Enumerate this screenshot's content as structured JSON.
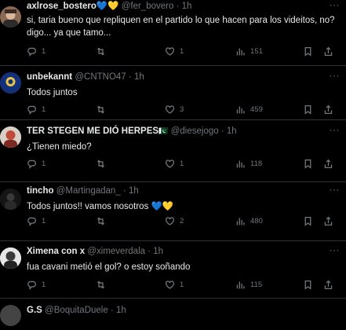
{
  "tweets": [
    {
      "name": "axlrose_bostero",
      "handle": "@fer_bovero",
      "dot": "·",
      "time": "1h",
      "emoji": "💙💛",
      "text": "si, taria bueno que repliquen en el partido lo que hacen para los videitos, no? digo... ya que tamo...",
      "replies": "1",
      "retweets": "",
      "likes": "1",
      "views": "151"
    },
    {
      "name": "unbekannt",
      "handle": "@CNTNO47",
      "dot": "·",
      "time": "1h",
      "emoji": "",
      "text": "Todos juntos",
      "replies": "1",
      "retweets": "",
      "likes": "3",
      "views": "459"
    },
    {
      "name": "TER STEGEN ME DIÓ HERPES",
      "handle": "@diesejogo",
      "dot": "·",
      "time": "1h",
      "emoji": "🇵🇰",
      "text": "¿Tienen miedo?",
      "replies": "1",
      "retweets": "",
      "likes": "1",
      "views": "118"
    },
    {
      "name": "tincho",
      "handle": "@Martingadan_",
      "dot": "·",
      "time": "1h",
      "emoji": "",
      "text": "Todos juntos!! vamos nosotros 💙💛",
      "replies": "1",
      "retweets": "",
      "likes": "2",
      "views": "480"
    },
    {
      "name": "Ximena con x",
      "handle": "@ximeverdala",
      "dot": "·",
      "time": "1h",
      "emoji": "",
      "text": "fua cavani metió el gol? o estoy soñando",
      "replies": "1",
      "retweets": "",
      "likes": "1",
      "views": "115"
    },
    {
      "name": "G.S",
      "handle": "@BoquitaDuele",
      "dot": "·",
      "time": "1h",
      "emoji": "",
      "text": "",
      "replies": "",
      "retweets": "",
      "likes": "",
      "views": ""
    }
  ],
  "more_label": "···",
  "icons": [
    "reply-icon",
    "retweet-icon",
    "like-icon",
    "views-icon",
    "bookmark-icon",
    "share-icon"
  ],
  "colors": {
    "background": "#000000",
    "text": "#e7e9ea",
    "muted": "#71767b",
    "divider": "#2f3336"
  }
}
